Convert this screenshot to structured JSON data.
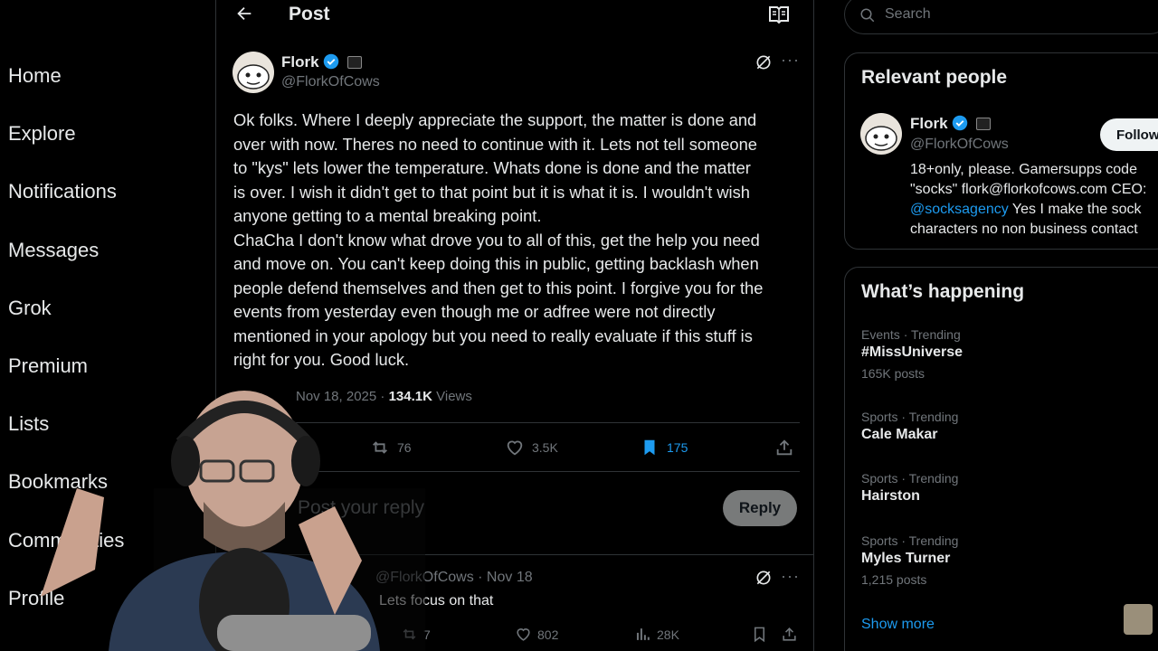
{
  "nav": {
    "items": [
      "Home",
      "Explore",
      "Notifications",
      "Messages",
      "Grok",
      "Premium",
      "Lists",
      "Bookmarks",
      "Communities",
      "Profile"
    ]
  },
  "header": {
    "title": "Post",
    "icons": [
      "back-arrow-icon",
      "reader-icon"
    ]
  },
  "post": {
    "author_name": "Flork",
    "handle": "@FlorkOfCows",
    "text": "Ok folks. Where I deeply appreciate the support, the matter is done and\nover with now. Theres no need to continue with it. Lets not tell someone\nto \"kys\" lets lower the temperature. Whats done is done and the matter\nis over. I wish it didn't get to that point but it is what it is. I wouldn't wish\nanyone getting to a mental breaking point.\nChaCha I don't know what drove you to all of this, get the help you need\nand move on. You can't keep doing this in public, getting backlash when\npeople defend themselves and then get to this point. I forgive you for the\nevents from yesterday even though me or adfree were not directly\nmentioned in your apology but you need to really evaluate if this stuff is\nright for you. Good luck.",
    "date": "Nov 18, 2025",
    "views_count": "134.1K",
    "views_label": "Views",
    "reposts": "76",
    "likes": "3.5K",
    "bookmarks": "175"
  },
  "reply_box": {
    "placeholder": "Post your reply",
    "button": "Reply"
  },
  "reply_post": {
    "handle": "@FlorkOfCows",
    "date": "Nov 18",
    "text": "Lets focus on that",
    "reposts": "7",
    "likes": "802",
    "views": "28K"
  },
  "search": {
    "placeholder": "Search"
  },
  "relevant_people": {
    "title": "Relevant people",
    "name": "Flork",
    "handle": "@FlorkOfCows",
    "follow_label": "Follow",
    "bio_line1": "18+only, please. Gamersupps code",
    "bio_line2": "\"socks\" flork@florkofcows.com CEO:",
    "bio_link": "@socksagency",
    "bio_line3_rest": " Yes I make the sock",
    "bio_line4": "characters no non business contact"
  },
  "whats_happening": {
    "title": "What’s happening",
    "trends": [
      {
        "category": "Events · Trending",
        "name": "#MissUniverse",
        "count": "165K posts"
      },
      {
        "category": "Sports · Trending",
        "name": "Cale Makar",
        "count": ""
      },
      {
        "category": "Sports · Trending",
        "name": "Hairston",
        "count": ""
      },
      {
        "category": "Sports · Trending",
        "name": "Myles Turner",
        "count": "1,215 posts"
      }
    ],
    "show_more": "Show more"
  },
  "colors": {
    "accent": "#1d9bf0",
    "background": "#000000",
    "muted": "#71767b",
    "text": "#e7e9ea",
    "border": "#2f3336"
  }
}
